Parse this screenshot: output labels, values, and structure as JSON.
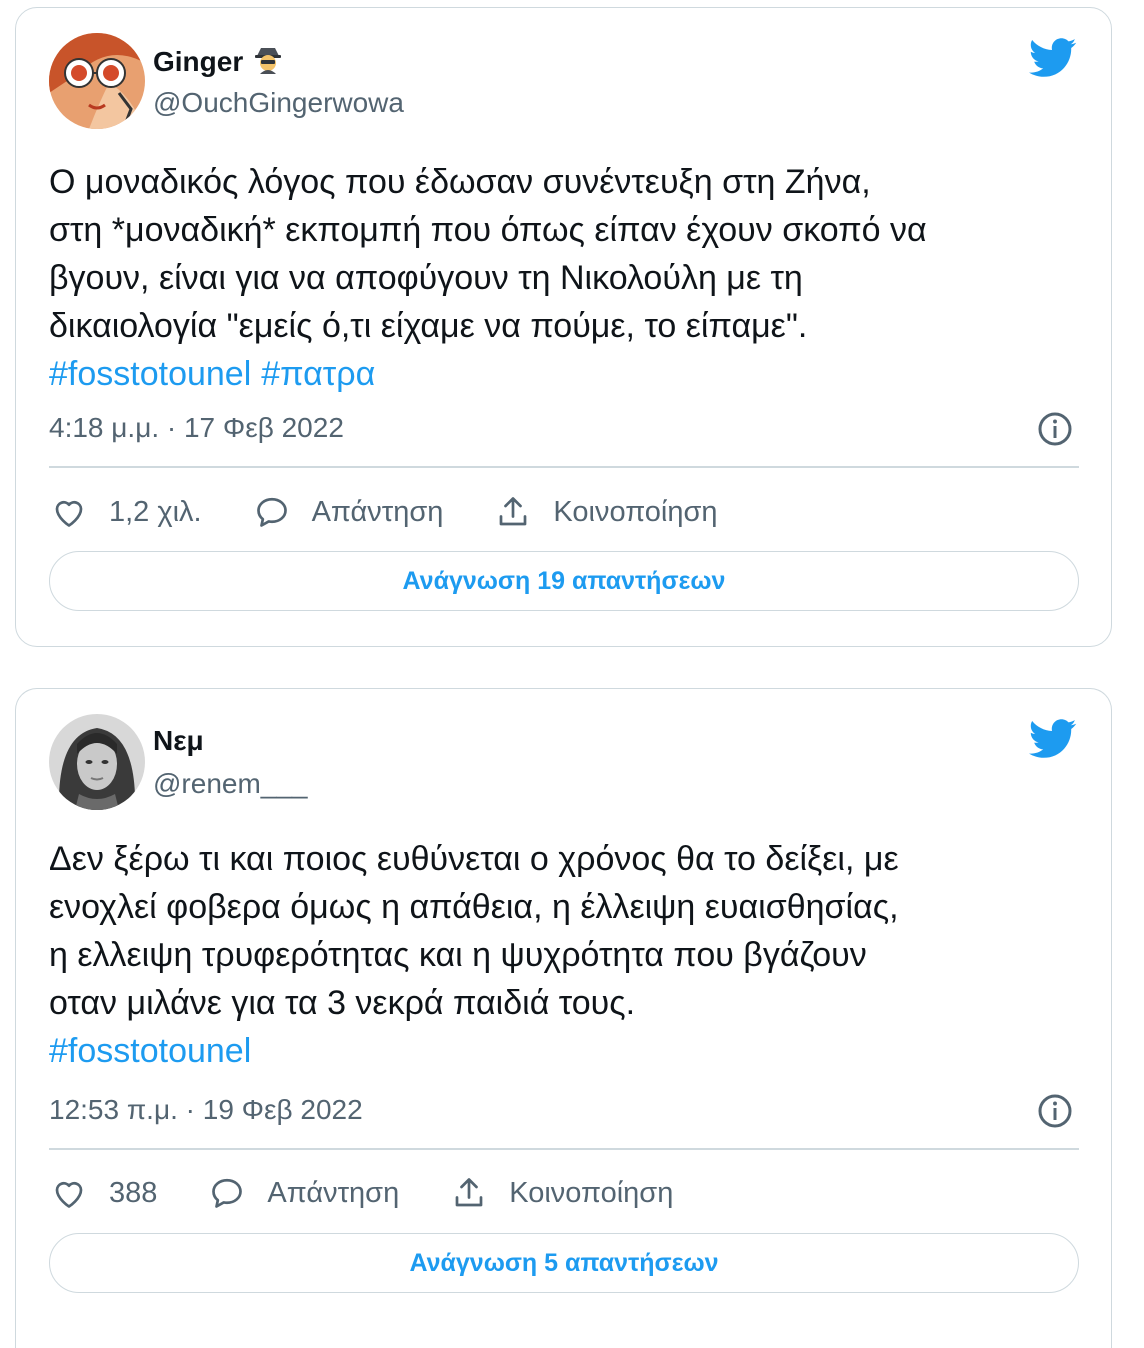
{
  "tweets": [
    {
      "name": "Ginger",
      "name_emoji": "🕵",
      "handle": "@OuchGingerwowa",
      "lines": [
        "Ο μοναδικός λόγος που έδωσαν συνέντευξη στη Ζήνα,",
        "στη *μοναδική* εκπομπή που όπως είπαν έχουν σκοπό να",
        "βγουν, είναι για να αποφύγουν τη Νικολούλη με τη",
        "δικαιολογία \"εμείς ό,τι είχαμε να πούμε, το είπαμε\"."
      ],
      "hashtags": [
        "#fosstotounel",
        "#πατρα"
      ],
      "timestamp": "4:18 μ.μ. · 17 Φεβ 2022",
      "likes": "1,2 χιλ.",
      "reply_label": "Απάντηση",
      "share_label": "Κοινοποίηση",
      "read_replies": "Ανάγνωση 19 απαντήσεων"
    },
    {
      "name": "Νεμ",
      "handle": "@renem___",
      "lines": [
        "Δεν ξέρω τι και ποιος ευθύνεται ο χρόνος θα το δείξει, με",
        "ενοχλεί φοβερα όμως η απάθεια, η έλλειψη ευαισθησίας,",
        "η ελλειψη τρυφερότητας και η ψυχρότητα που βγάζουν",
        "οταν μιλάνε για τα 3 νεκρά παιδιά τους."
      ],
      "hashtags": [
        "#fosstotounel"
      ],
      "timestamp": "12:53 π.μ. · 19 Φεβ 2022",
      "likes": "388",
      "reply_label": "Απάντηση",
      "share_label": "Κοινοποίηση",
      "read_replies": "Ανάγνωση 5 απαντήσεων"
    }
  ],
  "colors": {
    "accent": "#1d9bf0",
    "secondary_text": "#536471",
    "border": "#cfd9de"
  },
  "icons": [
    "twitter-bird-icon",
    "info-icon",
    "heart-icon",
    "reply-icon",
    "share-icon"
  ]
}
